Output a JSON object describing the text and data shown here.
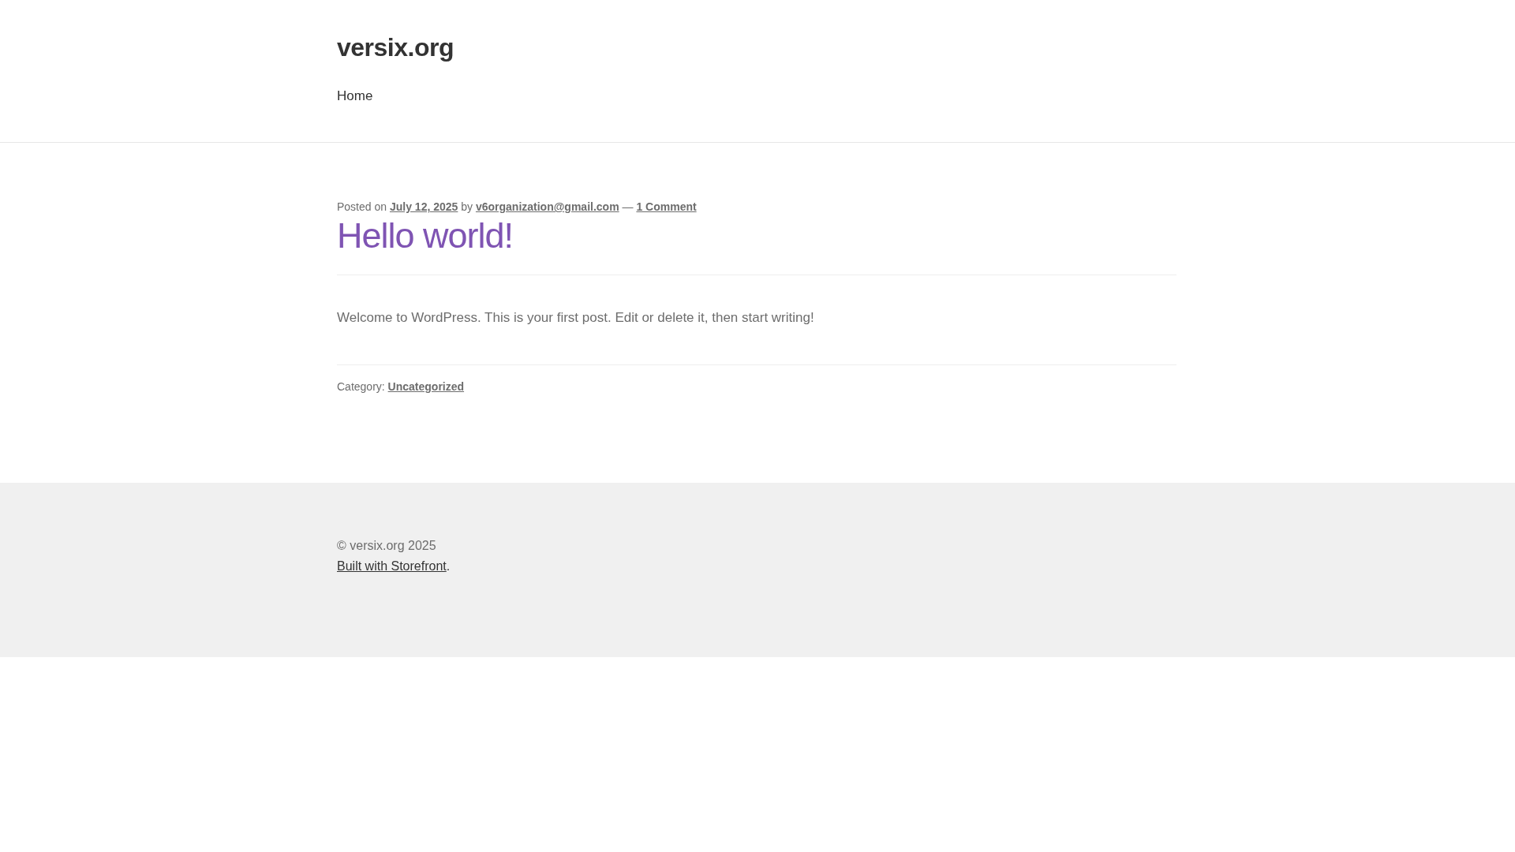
{
  "site_title": "versix.org",
  "nav": [
    {
      "label": "Home"
    }
  ],
  "post": {
    "meta": [
      {
        "kind": "text",
        "text": "Posted on "
      },
      {
        "kind": "link",
        "text": "July 12, 2025"
      },
      {
        "kind": "text",
        "text": " by "
      },
      {
        "kind": "link",
        "text": "v6organization@gmail.com"
      },
      {
        "kind": "text",
        "text": " — "
      },
      {
        "kind": "link",
        "text": "1 Comment"
      }
    ],
    "title": "Hello world!",
    "body": "Welcome to WordPress. This is your first post. Edit or delete it, then start writing!",
    "category": [
      {
        "kind": "text",
        "text": "Category: "
      },
      {
        "kind": "link",
        "text": "Uncategorized"
      }
    ]
  },
  "footer": {
    "copyright": "© versix.org 2025",
    "credit": [
      {
        "kind": "link",
        "text": "Built with Storefront"
      },
      {
        "kind": "text",
        "text": "."
      }
    ]
  }
}
